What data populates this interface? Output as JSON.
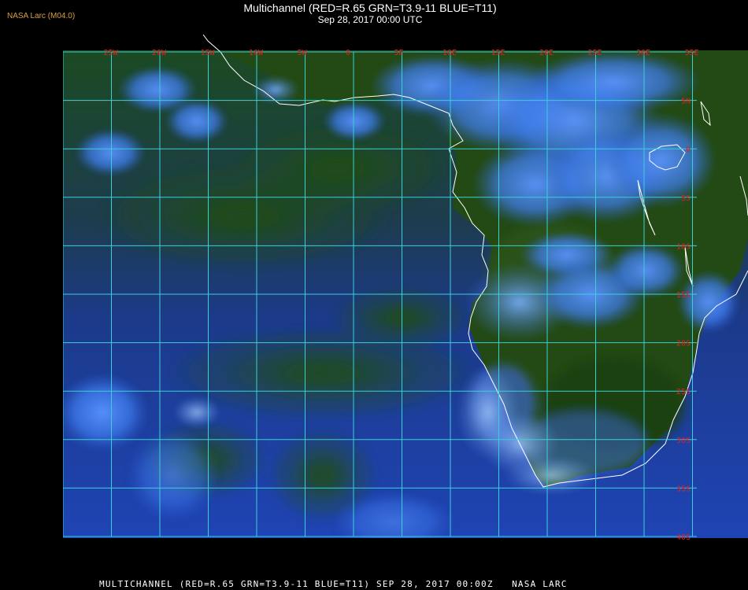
{
  "header": {
    "corner_label": "NASA Larc (M04.0)",
    "title": "Multichannel (RED=R.65 GRN=T3.9-11 BLUE=T11)",
    "subtitle": "Sep 28, 2017 00:00 UTC"
  },
  "footer": {
    "caption": "MULTICHANNEL (RED=R.65 GRN=T3.9-11 BLUE=T11) SEP 28, 2017 00:00Z   NASA LARC"
  },
  "map": {
    "longitude_labels": [
      "25W",
      "20W",
      "15W",
      "10W",
      "5W",
      "0",
      "5E",
      "10E",
      "15E",
      "20E",
      "25E",
      "30E",
      "35E"
    ],
    "latitude_labels": [
      "5N",
      "0",
      "5S",
      "10S",
      "15S",
      "20S",
      "25S",
      "30S",
      "35S",
      "40S"
    ],
    "colors": {
      "background": "#000000",
      "grid": "#3ad0d8",
      "grid_labels": "#e02020",
      "coastline": "#ffffff",
      "ocean_dark": "#1a3a9c",
      "land_green": "#1e4a12",
      "cloud_blue": "#3a7cf0"
    }
  }
}
